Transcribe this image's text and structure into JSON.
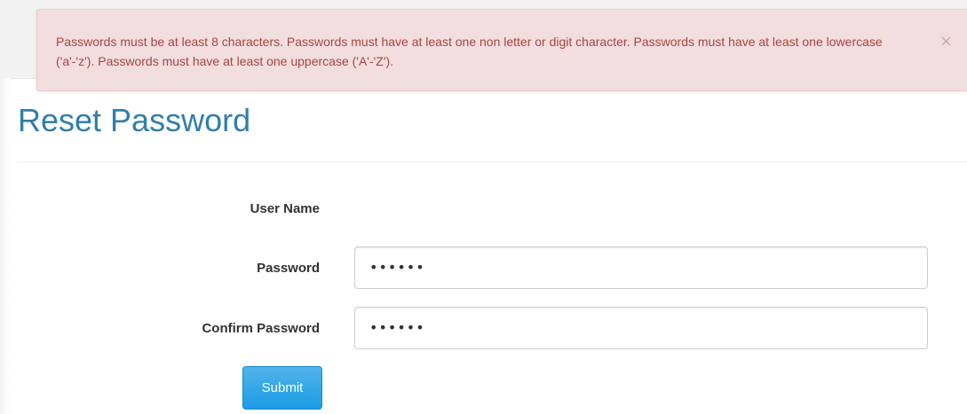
{
  "alert": {
    "message": "Passwords must be at least 8 characters. Passwords must have at least one non letter or digit character. Passwords must have at least one lowercase ('a'-'z'). Passwords must have at least one uppercase ('A'-'Z').",
    "close_glyph": "×",
    "color": "#a94442",
    "background": "#f2dede"
  },
  "page": {
    "title": "Reset Password",
    "title_color": "#317eac"
  },
  "form": {
    "username_label": "User Name",
    "password_label": "Password",
    "password_value": "••••••",
    "confirm_label": "Confirm Password",
    "confirm_value": "••••••",
    "submit_label": "Submit",
    "submit_color": "#2fa4e7"
  }
}
